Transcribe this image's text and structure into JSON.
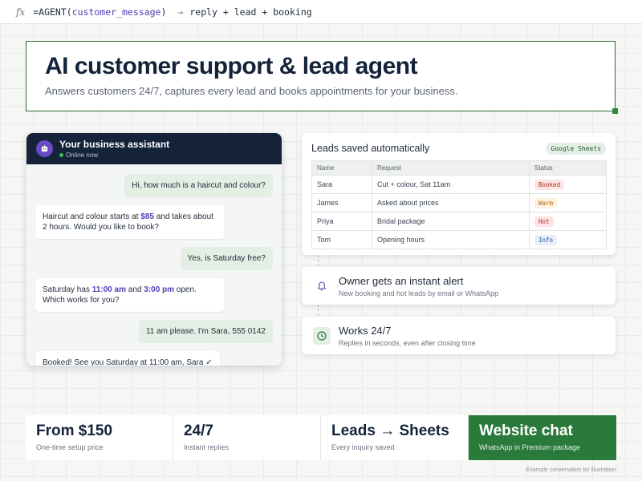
{
  "formula": {
    "fx": "fx",
    "fn": "=AGENT(",
    "arg": "customer_message",
    "close": ")",
    "arrow": "→",
    "result": "reply + lead + booking"
  },
  "hero": {
    "title": "AI customer support & lead agent",
    "subtitle": "Answers customers 24/7, captures every lead and books appointments for your business."
  },
  "chat": {
    "title": "Your business assistant",
    "status": "Online now",
    "messages": {
      "m1": "Hi, how much is a haircut and colour?",
      "m2a": "Haircut and colour starts at ",
      "m2b": "$85",
      "m2c": " and takes about 2 hours. Would you like to book?",
      "m3": "Yes, is Saturday free?",
      "m4a": "Saturday has ",
      "m4b": "11:00 am",
      "m4c": " and ",
      "m4d": "3:00 pm",
      "m4e": " open. Which works for you?",
      "m5": "11 am please. I'm Sara, 555 0142",
      "m6": "Booked! See you Saturday at 11:00 am, Sara ✓"
    }
  },
  "leads": {
    "title": "Leads saved automatically",
    "badge": "Google Sheets",
    "columns": [
      "Name",
      "Request",
      "Status"
    ],
    "rows": [
      {
        "name": "Sara",
        "request": "Cut + colour, Sat 11am",
        "status": "Booked"
      },
      {
        "name": "James",
        "request": "Asked about prices",
        "status": "Warm"
      },
      {
        "name": "Priya",
        "request": "Bridal package",
        "status": "Hot"
      },
      {
        "name": "Tom",
        "request": "Opening hours",
        "status": "Info"
      }
    ]
  },
  "features": [
    {
      "title": "Owner gets an instant alert",
      "subtitle": "New booking and hot leads by email or WhatsApp",
      "icon": "bell-icon"
    },
    {
      "title": "Works 24/7",
      "subtitle": "Replies in seconds, even after closing time",
      "icon": "clock-icon"
    }
  ],
  "stats": [
    {
      "value": "From $150",
      "label": "One-time setup price"
    },
    {
      "value": "24/7",
      "label": "Instant replies"
    },
    {
      "value": "Leads → Sheets",
      "label": "Every inquiry saved"
    },
    {
      "value": "Website chat",
      "label": "WhatsApp in Premium package"
    }
  ],
  "footnote": "Example conversation for illustration",
  "colors": {
    "navy": "#14233a",
    "green": "#2a7a3b",
    "purple": "#4b3fb5",
    "bot_avatar": "#6a4bc4"
  }
}
